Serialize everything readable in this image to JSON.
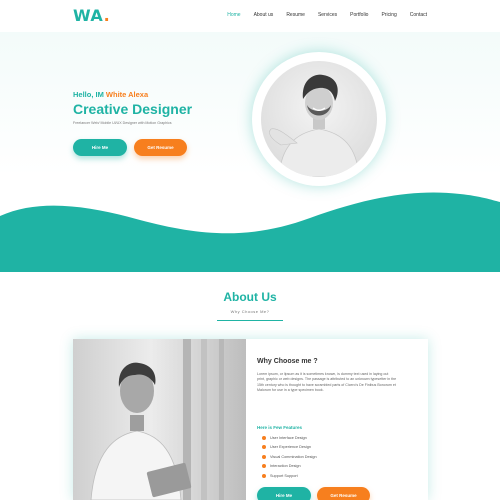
{
  "header": {
    "logo": "WA",
    "logo_dot": ".",
    "nav": [
      {
        "label": "Home",
        "active": true
      },
      {
        "label": "About us",
        "active": false
      },
      {
        "label": "Resume",
        "active": false
      },
      {
        "label": "Services",
        "active": false
      },
      {
        "label": "Portfolio",
        "active": false
      },
      {
        "label": "Pricing",
        "active": false
      },
      {
        "label": "Contact",
        "active": false
      }
    ]
  },
  "hero": {
    "greeting": "Hello, IM ",
    "name": "White Alexa",
    "role": "Creative Designer",
    "tagline": "Freelancer Web/ Mobile UI/UX Designer with Motion Graphics",
    "hire_label": "Hire Me",
    "resume_label": "Get Resume"
  },
  "about": {
    "title": "About Us",
    "subtitle": "Why Choose Me?",
    "why_title": "Why Choose me ?",
    "why_text": "Lorem ipsum, or lipsum as it is sometimes known, is dummy text used in laying out print, graphic or web designs. The passage is attributed to an unknown typesetter in the 15th century who is thought to have scrambled parts of Cicero's De Finibus Bonorum et Malorum for use in a type specimen book.",
    "features_title": "Here is Few Features",
    "features": [
      "User Interface Design",
      "User Experience Design",
      "Visual Commination Design",
      "Interaction Design",
      "Support Support"
    ],
    "hire_label": "Hire Me",
    "resume_label": "Get Resume"
  },
  "colors": {
    "primary": "#1fb3a4",
    "accent": "#f77f1e"
  }
}
